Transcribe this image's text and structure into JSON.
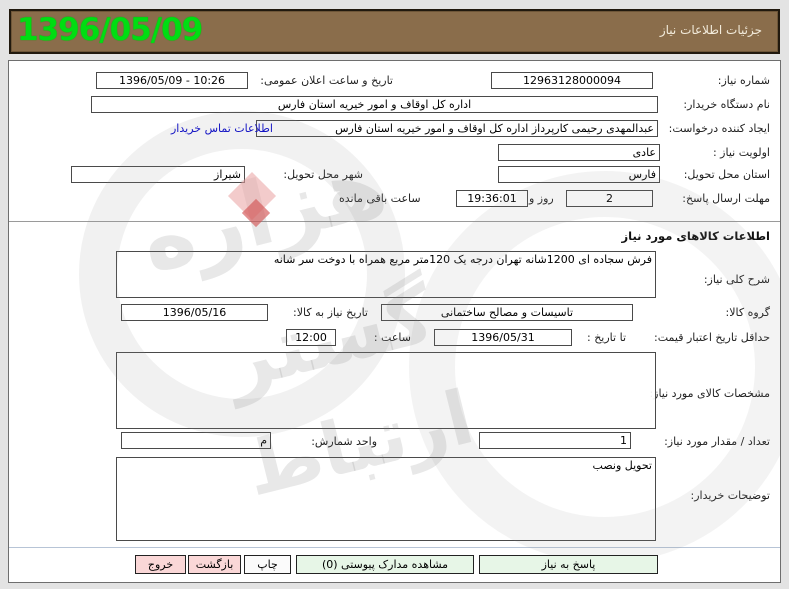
{
  "header": {
    "date": "1396/05/09",
    "title": "جزئیات اطلاعات نیاز"
  },
  "form": {
    "need_number": {
      "label": "شماره نیاز:",
      "value": "12963128000094"
    },
    "announce_datetime": {
      "label": "تاریخ و ساعت اعلان عمومی:",
      "value": "1396/05/09 - 10:26"
    },
    "buyer_org": {
      "label": "نام دستگاه خریدار:",
      "value": "اداره کل اوقاف و امور خیریه استان فارس"
    },
    "request_creator": {
      "label": "ایجاد کننده درخواست:",
      "value": "عبدالمهدی  رحیمی کارپرداز اداره کل اوقاف و امور خیریه استان فارس",
      "contact_link": "اطلاعات تماس خریدار"
    },
    "priority": {
      "label": "اولویت نیاز :",
      "value": "عادی"
    },
    "province": {
      "label": "استان محل تحویل:",
      "value": "فارس"
    },
    "city": {
      "label": "شهر محل تحویل:",
      "value": "شیراز"
    },
    "deadline": {
      "label": "مهلت ارسال پاسخ:",
      "days_value": "2",
      "days_suffix": "روز و",
      "time_value": "19:36:01",
      "time_suffix": "ساعت باقی مانده"
    },
    "section_title": "اطلاعات کالاهای مورد نیاز",
    "general_desc": {
      "label": "شرح کلی نیاز:",
      "value": "فرش سجاده ای 1200شانه تهران درجه یک 120متر مربع همراه با دوخت سر شانه"
    },
    "goods_group": {
      "label": "گروه کالا:",
      "value": "تاسیسات و مصالح ساختمانی"
    },
    "need_date": {
      "label": "تاریخ نیاز به کالا:",
      "value": "1396/05/16"
    },
    "price_validity": {
      "label": "حداقل تاریخ اعتبار قیمت:",
      "sub_label": "تا تاریخ :",
      "date_value": "1396/05/31",
      "hour_label": "ساعت :",
      "hour_value": "12:00"
    },
    "specs": {
      "label": "مشخصات کالای مورد نیاز:",
      "value": ""
    },
    "quantity": {
      "label": "تعداد / مقدار مورد نیاز:",
      "value": "1"
    },
    "unit": {
      "label": "واحد شمارش:",
      "value": "م"
    },
    "buyer_notes": {
      "label": "توضیحات خریدار:",
      "value": "تحویل ونصب"
    }
  },
  "buttons": {
    "respond": "پاسخ به نیاز",
    "view_docs": "مشاهده مدارک پیوستی (0)",
    "print": "چاپ",
    "back": "بازگشت",
    "exit": "خروج"
  },
  "watermark": {
    "glyphs": [
      "هزاره",
      "گستر",
      "ارتباط"
    ]
  },
  "colors": {
    "titlebar_bg": "#8a6d4b",
    "date_green": "#00dd12",
    "button_green": "#e7f6e7",
    "button_pink": "#fad7d7",
    "link_blue": "#0000cc"
  }
}
